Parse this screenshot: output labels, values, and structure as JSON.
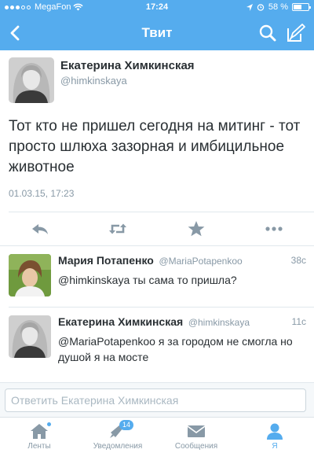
{
  "status_bar": {
    "carrier": "MegaFon",
    "time": "17:24",
    "battery": "58 %",
    "battery_level": 0.58
  },
  "nav": {
    "title": "Твит",
    "back_icon": "chevron-left-icon",
    "search_icon": "search-icon",
    "compose_icon": "compose-icon"
  },
  "tweet": {
    "author_name": "Екатерина Химкинская",
    "author_handle": "@himkinskaya",
    "text": "Тот кто не пришел сегодня на митинг - тот просто шлюха зазорная и имбицильное животное",
    "timestamp": "01.03.15, 17:23"
  },
  "replies": [
    {
      "name": "Мария Потапенко",
      "handle": "@MariaPotapenkoo",
      "time": "38с",
      "text": "@himkinskaya ты сама то пришла?"
    },
    {
      "name": "Екатерина Химкинская",
      "handle": "@himkinskaya",
      "time": "11с",
      "text": "@MariaPotapenkoo я за городом не смогла но душой я на мосте"
    }
  ],
  "reply_bar": {
    "placeholder": "Ответить Екатерина Химкинская"
  },
  "tabs": [
    {
      "label": "Ленты",
      "icon": "home-icon"
    },
    {
      "label": "Уведомления",
      "icon": "bell-icon",
      "badge": "14"
    },
    {
      "label": "Сообщения",
      "icon": "envelope-icon"
    },
    {
      "label": "Я",
      "icon": "person-icon"
    }
  ],
  "colors": {
    "accent": "#55acee",
    "text": "#292f33",
    "muted": "#8899a6"
  }
}
